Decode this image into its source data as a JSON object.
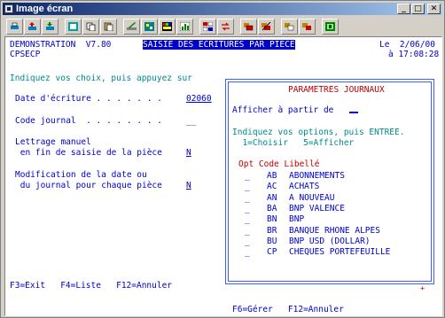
{
  "window": {
    "title": "Image écran"
  },
  "header": {
    "system": "DEMONSTRATION  V7.80",
    "program": "CPSECP",
    "banner": "SAISIE DES ECRITURES PAR PIECE",
    "date": "Le  2/06/00",
    "time": "à 17:08:28"
  },
  "form": {
    "instruction": "Indiquez vos choix, puis appuyez sur",
    "date_label": "Date d'écriture . . . . . . .",
    "date_value": "02060",
    "journal_label": "Code journal  . . . . . . . .",
    "journal_value": "__",
    "lettrage_label1": "Lettrage manuel",
    "lettrage_label2": " en fin de saisie de la pièce",
    "lettrage_value": "N",
    "modif_label1": "Modification de la date ou",
    "modif_label2": " du journal pour chaque pièce",
    "modif_value": "N"
  },
  "popup": {
    "title": "PARAMETRES JOURNAUX",
    "show_from": "Afficher à partir de",
    "instruction": "Indiquez vos options, puis ENTREE.",
    "options": "  1=Choisir   5=Afficher",
    "columns": "Opt Code Libellé",
    "rows": [
      {
        "opt": "_",
        "code": "AB",
        "label": "ABONNEMENTS"
      },
      {
        "opt": "_",
        "code": "AC",
        "label": "ACHATS"
      },
      {
        "opt": "_",
        "code": "AN",
        "label": "A NOUVEAU"
      },
      {
        "opt": "_",
        "code": "BA",
        "label": "BNP VALENCE"
      },
      {
        "opt": "_",
        "code": "BN",
        "label": "BNP"
      },
      {
        "opt": "_",
        "code": "BR",
        "label": "BANQUE RHONE ALPES"
      },
      {
        "opt": "_",
        "code": "BU",
        "label": "BNP USD (DOLLAR)"
      },
      {
        "opt": "_",
        "code": "CP",
        "label": "CHEQUES PORTEFEUILLE"
      }
    ],
    "more": "+",
    "footer": "F6=Gérer   F12=Annuler"
  },
  "footer": {
    "keys": "F3=Exit   F4=Liste   F12=Annuler"
  },
  "toolbar_icons": [
    "print-icon",
    "send-icon",
    "receive-icon",
    "display-icon",
    "copy-icon",
    "paste-icon",
    "edit-icon",
    "macro-icon",
    "color-icon",
    "graph-icon",
    "keyboard-icon",
    "transfer-icon",
    "connect-icon",
    "disconnect-icon",
    "session-icon",
    "settings-icon",
    "exit-icon"
  ]
}
